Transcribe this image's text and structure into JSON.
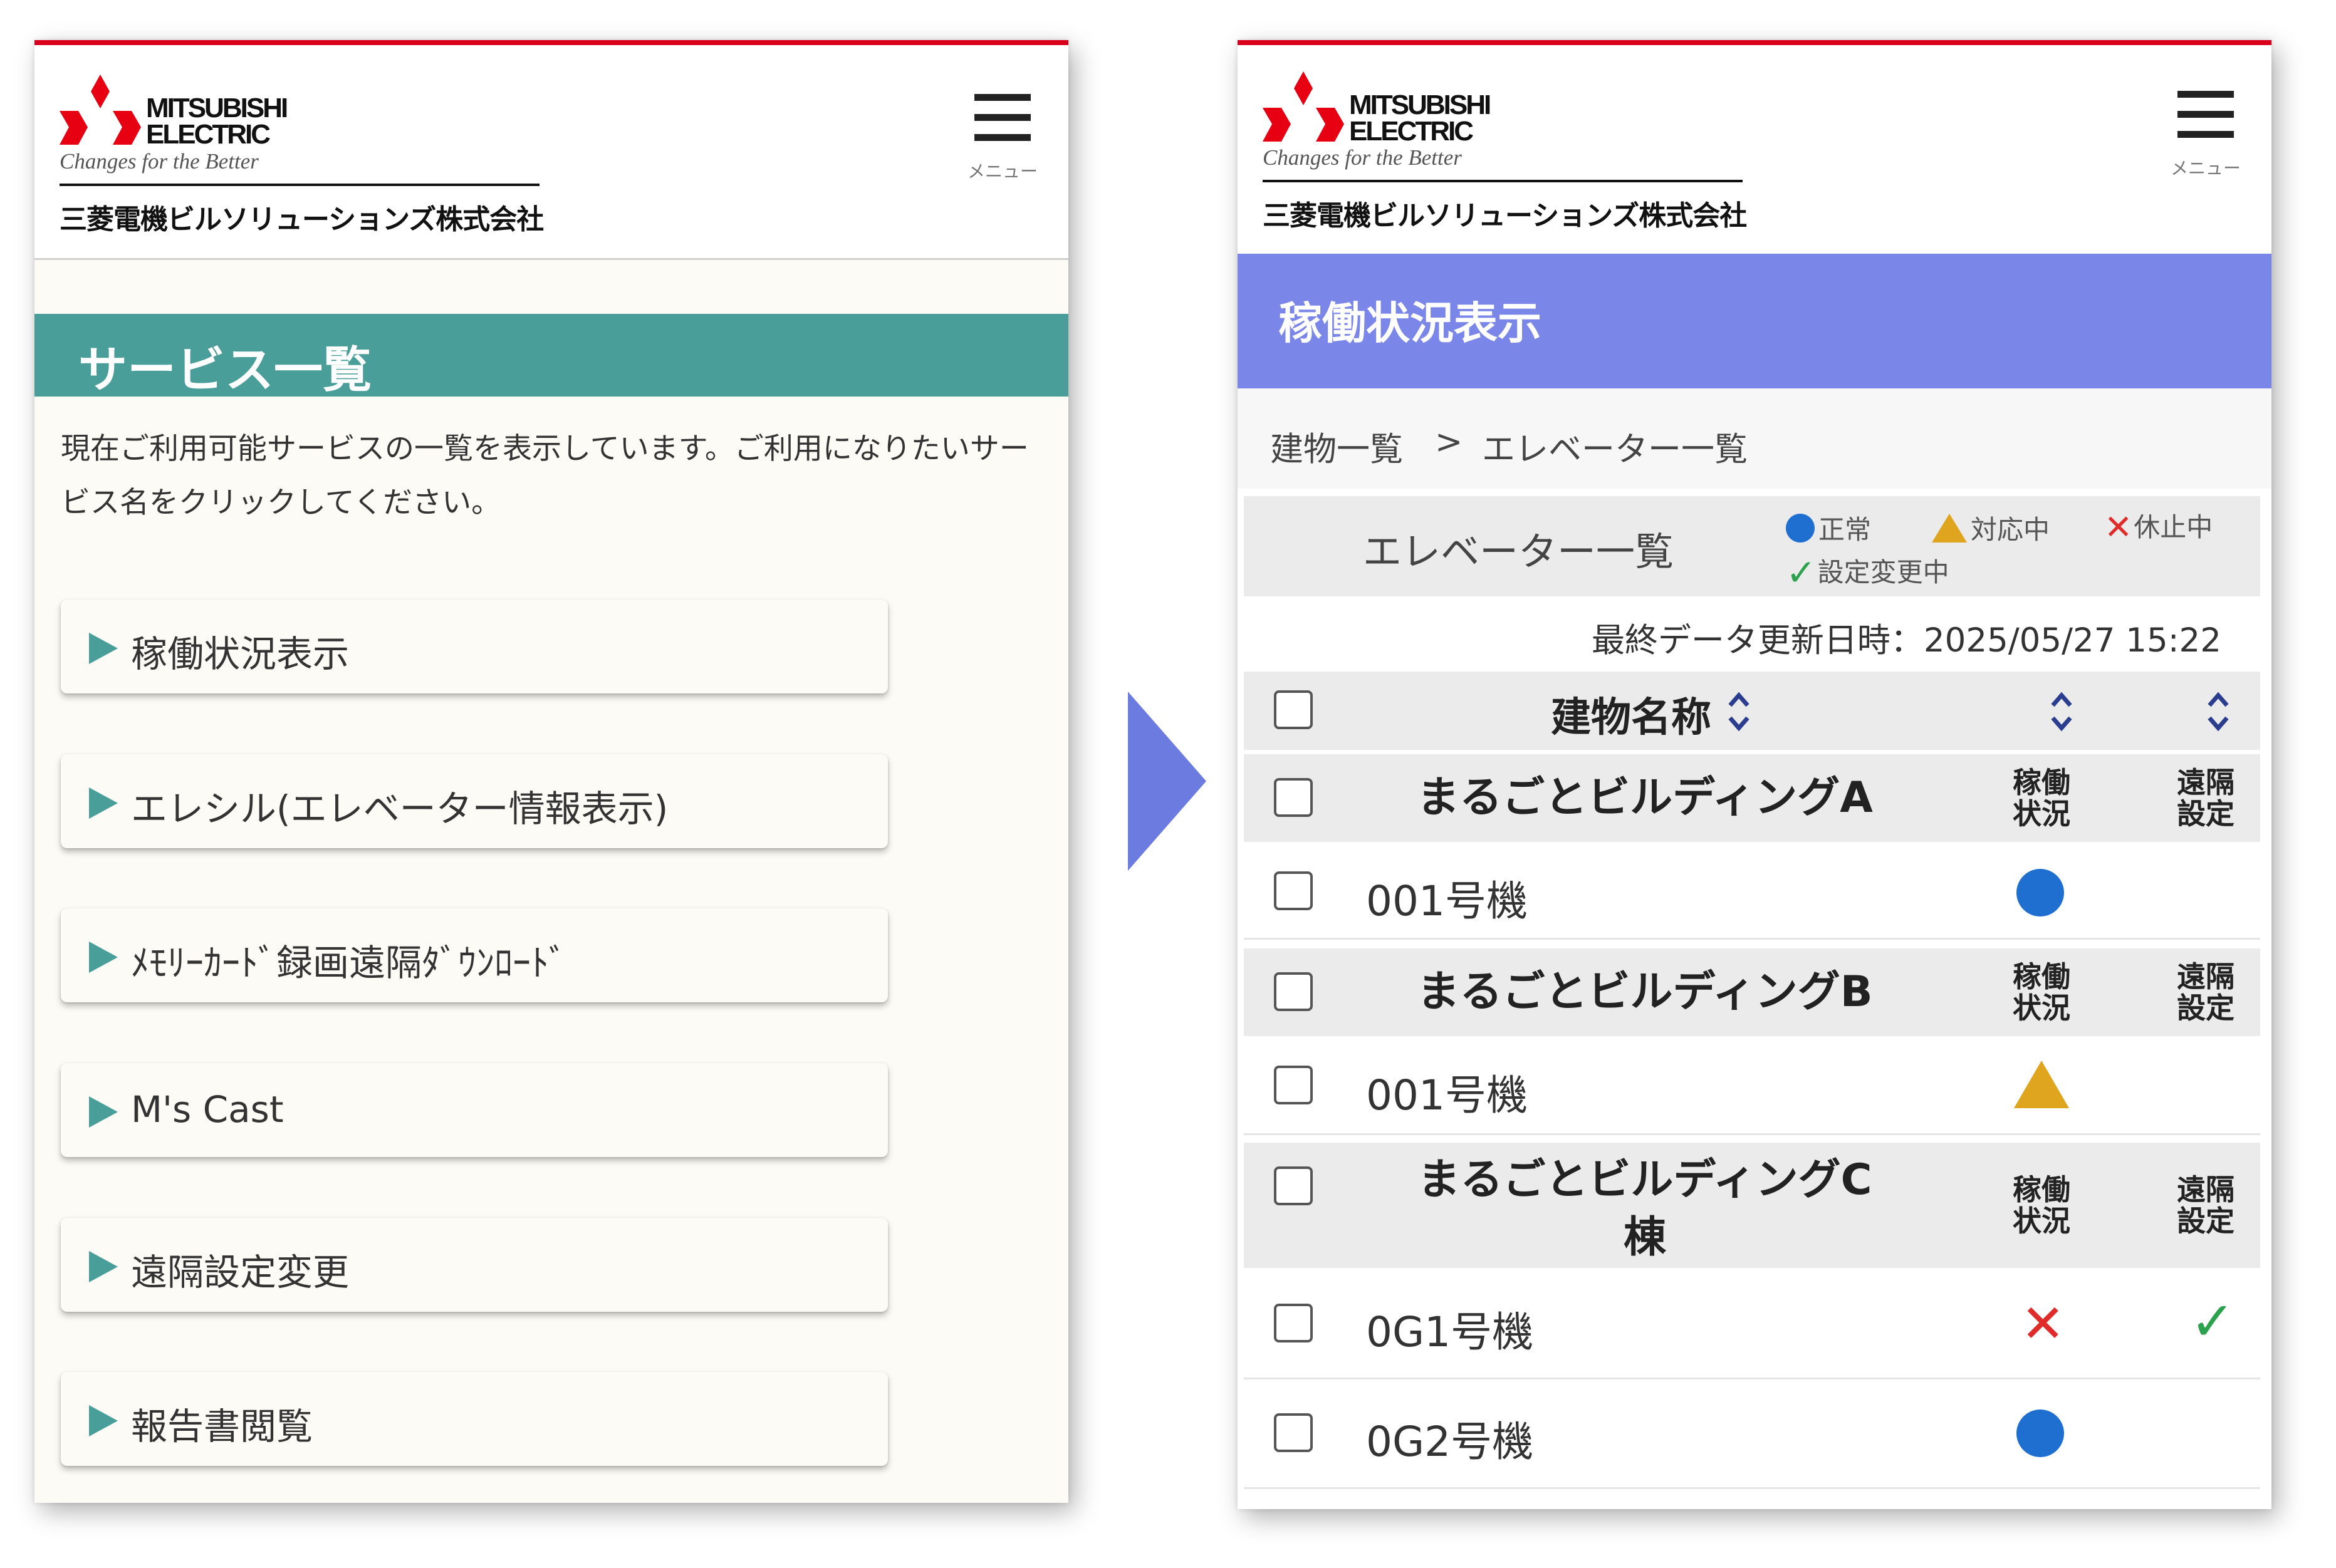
{
  "brand": {
    "name": "MITSUBISHI\nELECTRIC",
    "tagline": "Changes for the Better",
    "company": "三菱電機ビルソリューションズ株式会社",
    "menu_label": "メニュー"
  },
  "left_screen": {
    "title": "サービス一覧",
    "intro": "現在ご利用可能サービスの一覧を表示しています。ご利用になりたいサービス名をクリックしてください。",
    "services": [
      {
        "label": "稼働状況表示"
      },
      {
        "label": "エレシル(エレベーター情報表示)"
      },
      {
        "label": "ﾒﾓﾘｰｶｰﾄﾞ録画遠隔ﾀﾞｳﾝﾛｰﾄﾞ"
      },
      {
        "label": "M's Cast"
      },
      {
        "label": "遠隔設定変更"
      },
      {
        "label": "報告書閲覧"
      }
    ]
  },
  "right_screen": {
    "title": "稼働状況表示",
    "breadcrumb": {
      "item1": "建物一覧",
      "separator": ">",
      "item2": "エレベーター一覧"
    },
    "list_title": "エレベーター一覧",
    "legend": {
      "normal": "正常",
      "in_progress": "対応中",
      "stopped": "休止中",
      "setting_changing": "設定変更中"
    },
    "last_updated": "最終データ更新日時：2025/05/27 15:22",
    "table": {
      "header": {
        "building_name": "建物名称"
      },
      "col_operation": "稼働\n状況",
      "col_remote": "遠隔\n設定",
      "groups": [
        {
          "building": "まるごとビルディングA",
          "units": [
            {
              "name": "001号機",
              "status": "normal",
              "remote": ""
            }
          ]
        },
        {
          "building": "まるごとビルディングB",
          "units": [
            {
              "name": "001号機",
              "status": "in_progress",
              "remote": ""
            }
          ]
        },
        {
          "building": "まるごとビルディングC\n棟",
          "units": [
            {
              "name": "0G1号機",
              "status": "stopped",
              "remote": "setting_changing"
            },
            {
              "name": "0G2号機",
              "status": "normal",
              "remote": ""
            }
          ]
        }
      ]
    }
  },
  "colors": {
    "brand_red": "#d9001b",
    "teal": "#4a9e9a",
    "periwinkle": "#7a86e8",
    "status_normal": "#1f6fd1",
    "status_in_progress": "#e0a51e",
    "status_stopped": "#e02b2b",
    "status_setting": "#2ca24f"
  },
  "icons": [
    "mitsubishi-logo-icon",
    "hamburger-menu-icon",
    "play-arrow-icon",
    "sort-icon",
    "checkbox-icon",
    "status-circle-icon",
    "status-triangle-icon",
    "status-cross-icon",
    "status-check-icon",
    "transition-arrow-icon"
  ]
}
